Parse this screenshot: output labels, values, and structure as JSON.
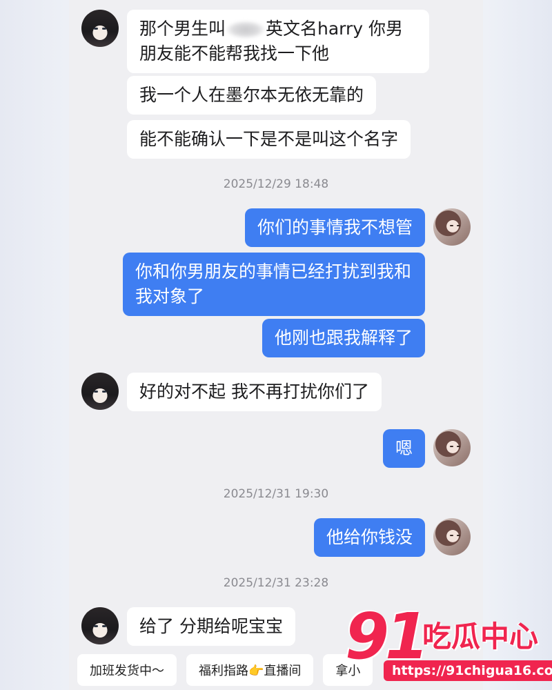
{
  "messages": [
    {
      "from": "other",
      "text_before": "那个男生叫",
      "text_after": "英文名harry 你男朋友能不能帮我找一下他"
    },
    {
      "from": "other",
      "text": "我一个人在墨尔本无依无靠的"
    },
    {
      "from": "other",
      "text": "能不能确认一下是不是叫这个名字"
    },
    {
      "from": "me",
      "text": "你们的事情我不想管"
    },
    {
      "from": "me",
      "text": "你和你男朋友的事情已经打扰到我和我对象了"
    },
    {
      "from": "me",
      "text": "他刚也跟我解释了"
    },
    {
      "from": "other",
      "text": "好的对不起 我不再打扰你们了"
    },
    {
      "from": "me",
      "text": "嗯"
    },
    {
      "from": "me",
      "text": "他给你钱没"
    },
    {
      "from": "other",
      "text": "给了 分期给呢宝宝"
    }
  ],
  "timestamps": [
    "2025/12/29 18:48",
    "2025/12/31 19:30",
    "2025/12/31 23:28"
  ],
  "quick_replies": [
    "加班发货中～",
    "福利指路👉直播间",
    "拿小"
  ],
  "watermark": {
    "number": "91",
    "name": "吃瓜中心",
    "url": "https://91chigua16.com"
  },
  "colors": {
    "sent_bubble": "#3f7ef2",
    "received_bubble": "#ffffff",
    "background": "#efeff2",
    "watermark": "#f0254f"
  }
}
